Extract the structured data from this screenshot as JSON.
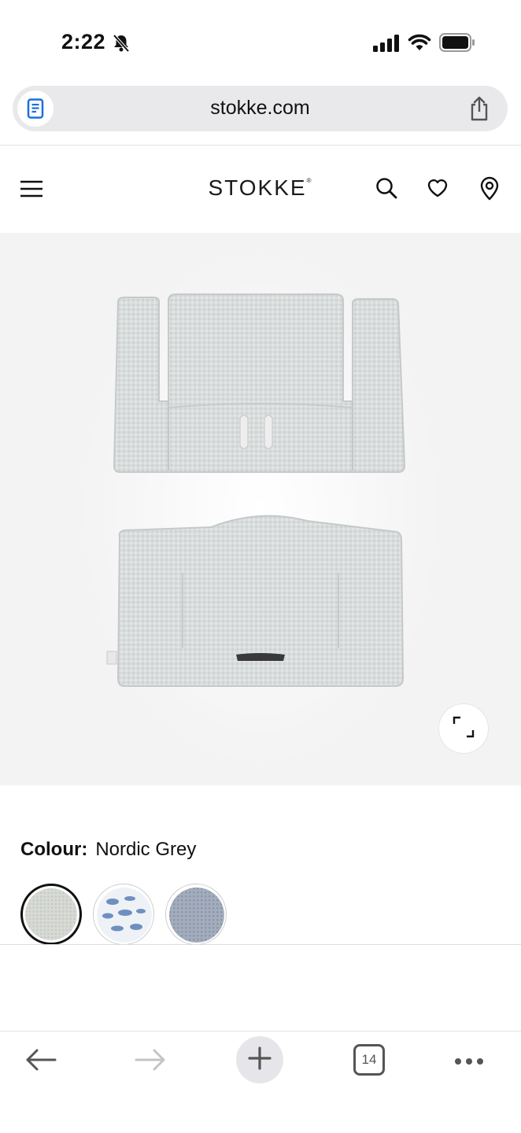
{
  "status_bar": {
    "time": "2:22"
  },
  "browser": {
    "url": "stokke.com",
    "tab_count": "14"
  },
  "site": {
    "logo": "STOKKE",
    "logo_mark": "®"
  },
  "product": {
    "colour_label": "Colour:",
    "colour_value": "Nordic Grey",
    "swatches": [
      "Nordic Grey",
      "Blue Pattern",
      "Blue Grey"
    ]
  },
  "colors": {
    "accent": "#111111",
    "image_bg": "#f3f3f3",
    "cushion": "#d9dcdc"
  },
  "icons": [
    "bell-slash-icon",
    "signal-icon",
    "wifi-icon",
    "battery-icon",
    "reader-icon",
    "share-icon",
    "menu-icon",
    "search-icon",
    "heart-icon",
    "location-pin-icon",
    "expand-icon",
    "back-arrow-icon",
    "forward-arrow-icon",
    "plus-icon",
    "more-icon"
  ]
}
